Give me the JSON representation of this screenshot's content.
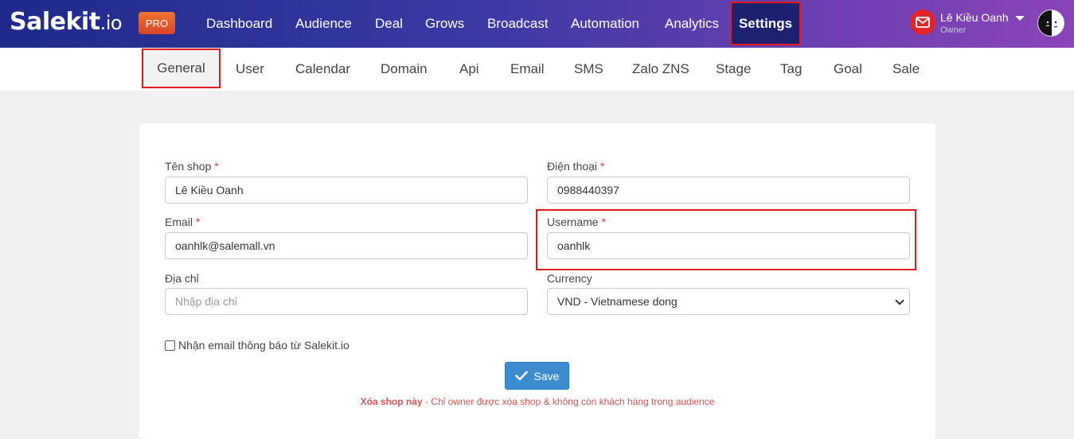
{
  "brand": {
    "logo_main": "Salekit",
    "logo_suffix": ".io",
    "badge": "PRO"
  },
  "nav": {
    "items": [
      "Dashboard",
      "Audience",
      "Deal",
      "Grows",
      "Broadcast",
      "Automation",
      "Analytics"
    ],
    "active": "Settings"
  },
  "user": {
    "name": "Lê Kiều Oanh",
    "role": "Owner"
  },
  "subnav": {
    "active": "General",
    "items": [
      "User",
      "Calendar",
      "Domain",
      "Api",
      "Email",
      "SMS",
      "Zalo ZNS",
      "Stage",
      "Tag",
      "Goal",
      "Sale"
    ]
  },
  "form": {
    "shop_name": {
      "label": "Tên shop",
      "required": "*",
      "value": "Lê Kiều Oanh"
    },
    "phone": {
      "label": "Điện thoại",
      "required": "*",
      "value": "0988440397"
    },
    "email": {
      "label": "Email",
      "required": "*",
      "value": "oanhlk@salemall.vn"
    },
    "username": {
      "label": "Username",
      "required": "*",
      "value": "oanhlk"
    },
    "address": {
      "label": "Địa chỉ",
      "placeholder": "Nhập địa chỉ",
      "value": ""
    },
    "currency": {
      "label": "Currency",
      "value": "VND - Vietnamese dong"
    },
    "notify_checkbox": {
      "label": "Nhận email thông báo từ Salekit.io",
      "checked": false
    },
    "save_label": "Save",
    "delete_link": "Xóa shop này",
    "delete_note": " - Chỉ owner được xóa shop & không còn khách hàng trong audience"
  },
  "colors": {
    "accent": "#3b8dd0",
    "highlight": "#e01b1b",
    "danger": "#d9534f"
  }
}
